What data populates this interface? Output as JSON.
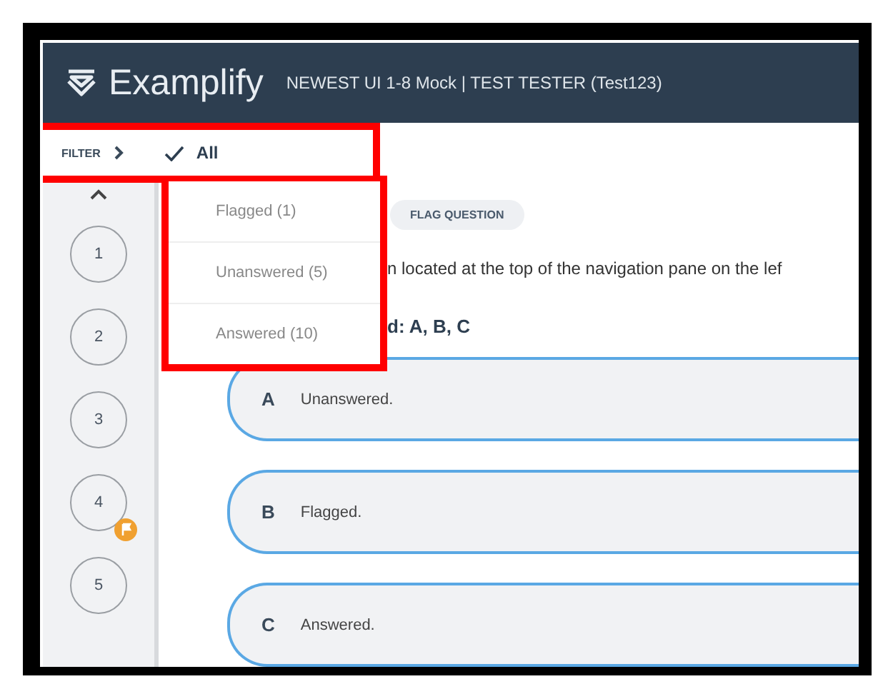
{
  "header": {
    "logo": "Examplify",
    "exam_title": "NEWEST UI 1-8 Mock | TEST TESTER (Test123)"
  },
  "filter": {
    "label": "FILTER",
    "options": [
      {
        "label": "All",
        "selected": true
      },
      {
        "label": "Flagged (1)",
        "selected": false
      },
      {
        "label": "Unanswered (5)",
        "selected": false
      },
      {
        "label": "Answered (10)",
        "selected": false
      }
    ]
  },
  "questions": [
    {
      "number": "1",
      "flagged": false
    },
    {
      "number": "2",
      "flagged": false
    },
    {
      "number": "3",
      "flagged": false
    },
    {
      "number": "4",
      "flagged": true
    },
    {
      "number": "5",
      "flagged": false
    }
  ],
  "flag_button": "FLAG QUESTION",
  "question_text": "n located at the top of the navigation pane on the lef",
  "answer_line": "d: A, B, C",
  "choices": [
    {
      "letter": "A",
      "text": "Unanswered."
    },
    {
      "letter": "B",
      "text": "Flagged."
    },
    {
      "letter": "C",
      "text": "Answered."
    }
  ]
}
